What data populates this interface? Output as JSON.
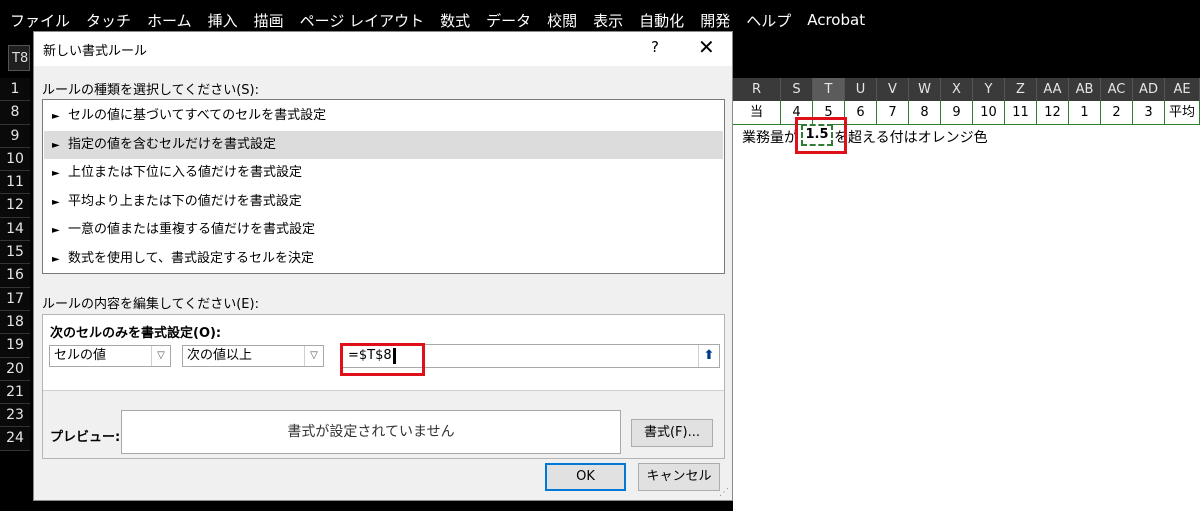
{
  "ribbon": {
    "tabs": [
      "ファイル",
      "タッチ",
      "ホーム",
      "挿入",
      "描画",
      "ページ レイアウト",
      "数式",
      "データ",
      "校閲",
      "表示",
      "自動化",
      "開発",
      "ヘルプ",
      "Acrobat"
    ]
  },
  "namebox": {
    "value": "T8"
  },
  "sheet": {
    "row_numbers": [
      "1",
      "8",
      "9",
      "10",
      "11",
      "12",
      "14",
      "15",
      "16",
      "17",
      "18",
      "19",
      "20",
      "21",
      "23",
      "24"
    ],
    "columns": [
      {
        "letter": "R",
        "width": 48
      },
      {
        "letter": "S",
        "width": 32
      },
      {
        "letter": "T",
        "width": 32,
        "selected": true
      },
      {
        "letter": "U",
        "width": 32
      },
      {
        "letter": "V",
        "width": 32
      },
      {
        "letter": "W",
        "width": 32
      },
      {
        "letter": "X",
        "width": 32
      },
      {
        "letter": "Y",
        "width": 32
      },
      {
        "letter": "Z",
        "width": 32
      },
      {
        "letter": "AA",
        "width": 32
      },
      {
        "letter": "AB",
        "width": 32
      },
      {
        "letter": "AC",
        "width": 32
      },
      {
        "letter": "AD",
        "width": 32
      },
      {
        "letter": "AE",
        "width": 35
      }
    ],
    "row1_cells": [
      "当",
      "4",
      "5",
      "6",
      "7",
      "8",
      "9",
      "10",
      "11",
      "12",
      "1",
      "2",
      "3",
      "平均"
    ],
    "note_pre": "業務量が",
    "t8_value": "1.5",
    "note_post": "を超える付はオレンジ色"
  },
  "dialog": {
    "title": "新しい書式ルール",
    "help": "?",
    "close": "✕",
    "select_type_label": "ルールの種類を選択してください(S):",
    "rules": [
      "セルの値に基づいてすべてのセルを書式設定",
      "指定の値を含むセルだけを書式設定",
      "上位または下位に入る値だけを書式設定",
      "平均より上または下の値だけを書式設定",
      "一意の値または重複する値だけを書式設定",
      "数式を使用して、書式設定するセルを決定"
    ],
    "selected_rule_index": 1,
    "edit_label": "ルールの内容を編集してください(E):",
    "only_cells_label": "次のセルのみを書式設定(O):",
    "combo1": "セルの値",
    "combo2": "次の値以上",
    "formula": "=$T$8",
    "preview_label": "プレビュー:",
    "preview_text": "書式が設定されていません",
    "format_button": "書式(F)...",
    "ok_button": "OK",
    "cancel_button": "キャンセル"
  }
}
